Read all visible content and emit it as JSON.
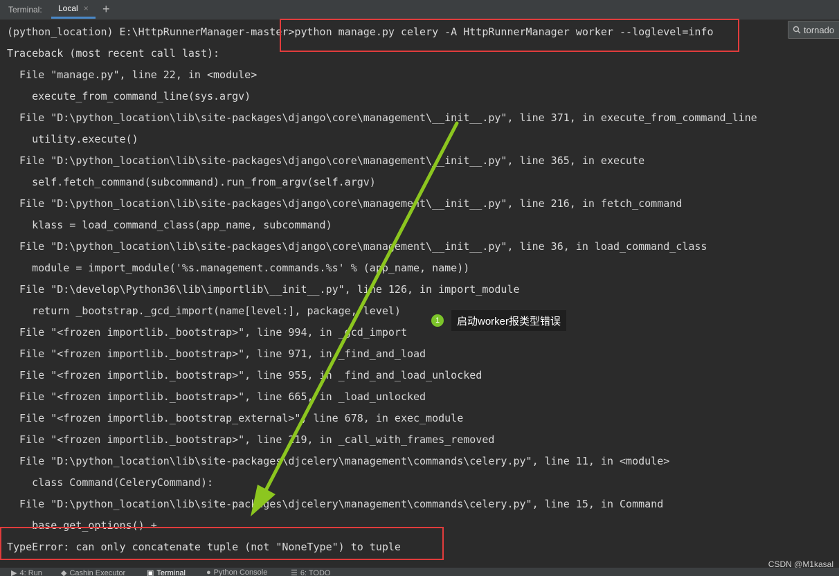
{
  "tabbar": {
    "title": "Terminal:",
    "tab_label": "Local",
    "close_glyph": "×",
    "add_glyph": "+"
  },
  "search": {
    "value": "tornado",
    "icon": "search-icon"
  },
  "terminal_lines": [
    "(python_location) E:\\HttpRunnerManager-master>python manage.py celery -A HttpRunnerManager worker --loglevel=info",
    "Traceback (most recent call last):",
    "  File \"manage.py\", line 22, in <module>",
    "    execute_from_command_line(sys.argv)",
    "  File \"D:\\python_location\\lib\\site-packages\\django\\core\\management\\__init__.py\", line 371, in execute_from_command_line",
    "    utility.execute()",
    "  File \"D:\\python_location\\lib\\site-packages\\django\\core\\management\\__init__.py\", line 365, in execute",
    "    self.fetch_command(subcommand).run_from_argv(self.argv)",
    "  File \"D:\\python_location\\lib\\site-packages\\django\\core\\management\\__init__.py\", line 216, in fetch_command",
    "    klass = load_command_class(app_name, subcommand)",
    "  File \"D:\\python_location\\lib\\site-packages\\django\\core\\management\\__init__.py\", line 36, in load_command_class",
    "    module = import_module('%s.management.commands.%s' % (app_name, name))",
    "  File \"D:\\develop\\Python36\\lib\\importlib\\__init__.py\", line 126, in import_module",
    "    return _bootstrap._gcd_import(name[level:], package, level)",
    "  File \"<frozen importlib._bootstrap>\", line 994, in _gcd_import",
    "  File \"<frozen importlib._bootstrap>\", line 971, in _find_and_load",
    "  File \"<frozen importlib._bootstrap>\", line 955, in _find_and_load_unlocked",
    "  File \"<frozen importlib._bootstrap>\", line 665, in _load_unlocked",
    "  File \"<frozen importlib._bootstrap_external>\", line 678, in exec_module",
    "  File \"<frozen importlib._bootstrap>\", line 219, in _call_with_frames_removed",
    "  File \"D:\\python_location\\lib\\site-packages\\djcelery\\management\\commands\\celery.py\", line 11, in <module>",
    "    class Command(CeleryCommand):",
    "  File \"D:\\python_location\\lib\\site-packages\\djcelery\\management\\commands\\celery.py\", line 15, in Command",
    "    base.get_options() +",
    "TypeError: can only concatenate tuple (not \"NoneType\") to tuple"
  ],
  "callout": {
    "number": "1",
    "text": "启动worker报类型错误"
  },
  "colors": {
    "highlight_box": "#e13c3c",
    "arrow": "#8cc61f"
  },
  "bottom_bar": [
    {
      "icon": "run-icon",
      "label": "4: Run"
    },
    {
      "icon": "cashin-icon",
      "label": "Cashin Executor"
    },
    {
      "icon": "terminal-icon",
      "label": "Terminal"
    },
    {
      "icon": "python-icon",
      "label": "Python Console"
    },
    {
      "icon": "todo-icon",
      "label": "6: TODO"
    }
  ],
  "watermark": "CSDN @M1kasal"
}
